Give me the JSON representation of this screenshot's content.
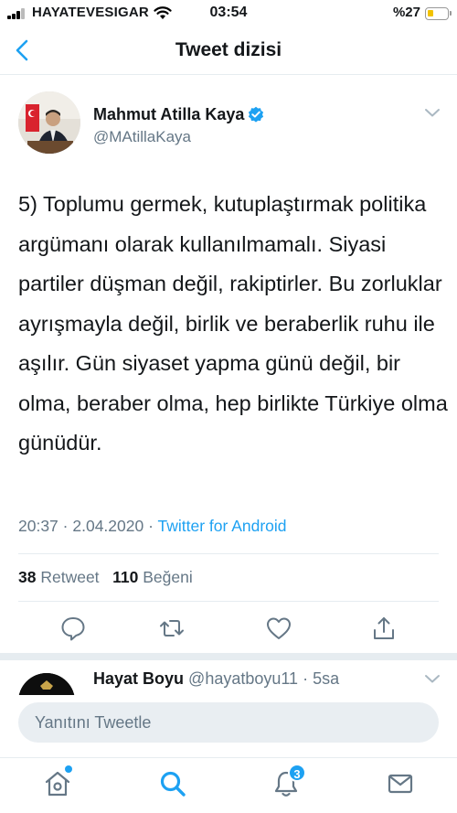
{
  "status_bar": {
    "carrier": "HAYATEVESIGAR",
    "time": "03:54",
    "battery": "%27",
    "battery_level": 0.27
  },
  "nav": {
    "title": "Tweet dizisi",
    "back_icon": "chevron-left-icon"
  },
  "tweet": {
    "author_name": "Mahmut Atilla Kaya",
    "author_handle": "@MAtillaKaya",
    "verified": true,
    "text": "5) Toplumu germek, kutuplaştırmak politika argümanı olarak kullanılmamalı. Siyasi partiler düşman değil, rakiptirler. Bu zorluklar ayrışmayla değil, birlik ve beraberlik ruhu ile aşılır. Gün siyaset yapma günü değil, bir olma, beraber olma, hep birlikte Türkiye olma günüdür.",
    "time": "20:37",
    "date": "2.04.2020",
    "dot": "·",
    "source": "Twitter for Android",
    "retweet_count": "38",
    "retweet_label": "Retweet",
    "like_count": "110",
    "like_label": "Beğeni"
  },
  "reply_preview": {
    "name": "Hayat Boyu",
    "handle_time": "@hayatboyu11 · 5sa"
  },
  "composer": {
    "placeholder": "Yanıtını Tweetle"
  },
  "tabbar": {
    "notifications_badge": "3"
  },
  "colors": {
    "accent": "#1da1f2",
    "secondary_text": "#657786",
    "divider": "#e6ecf0"
  }
}
